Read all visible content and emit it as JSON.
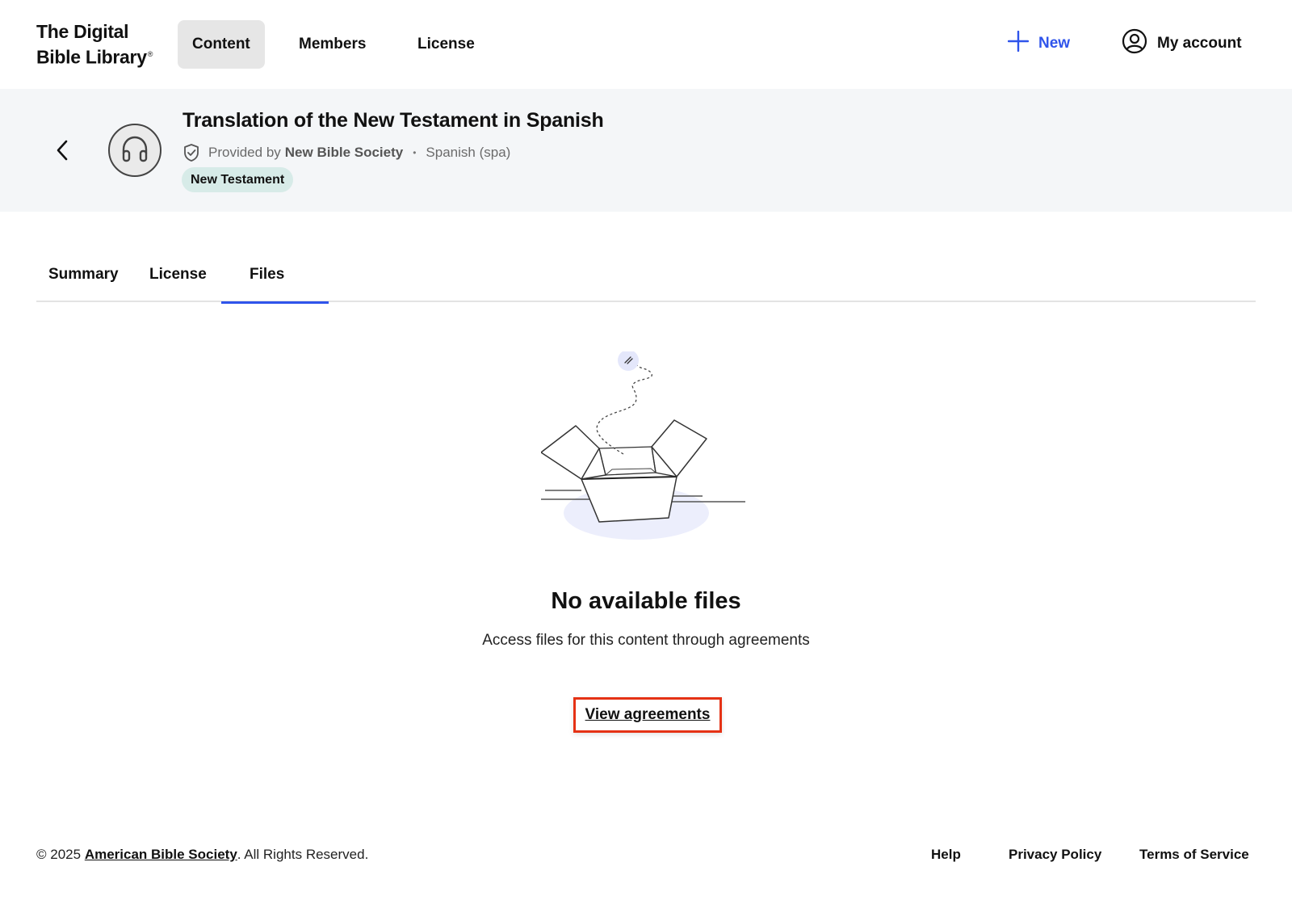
{
  "header": {
    "logo_line1": "The Digital",
    "logo_line2": "Bible Library",
    "logo_mark": "®",
    "nav": [
      {
        "label": "Content",
        "active": true
      },
      {
        "label": "Members",
        "active": false
      },
      {
        "label": "License",
        "active": false
      }
    ],
    "new_label": "New",
    "account_label": "My account",
    "accent_color": "#2f54eb"
  },
  "content_header": {
    "title": "Translation of the New Testament in Spanish",
    "provided_by_prefix": "Provided by",
    "provider": "New Bible Society",
    "separator": "•",
    "language": "Spanish (spa)",
    "tag": "New Testament",
    "media_icon": "headphones-icon",
    "verified_icon": "shield-check-icon",
    "back_icon": "chevron-left-icon"
  },
  "tabs": [
    {
      "label": "Summary",
      "active": false
    },
    {
      "label": "License",
      "active": false
    },
    {
      "label": "Files",
      "active": true
    }
  ],
  "empty_state": {
    "illustration": "empty-box-illustration",
    "title": "No available files",
    "subtitle": "Access files for this content through agreements",
    "action_label": "View agreements",
    "highlight_color": "#e53215"
  },
  "footer": {
    "copyright_prefix": "© 2025",
    "organization": "American Bible Society",
    "copyright_suffix": ". All Rights Reserved.",
    "links": [
      "Help",
      "Privacy Policy",
      "Terms of Service"
    ]
  }
}
